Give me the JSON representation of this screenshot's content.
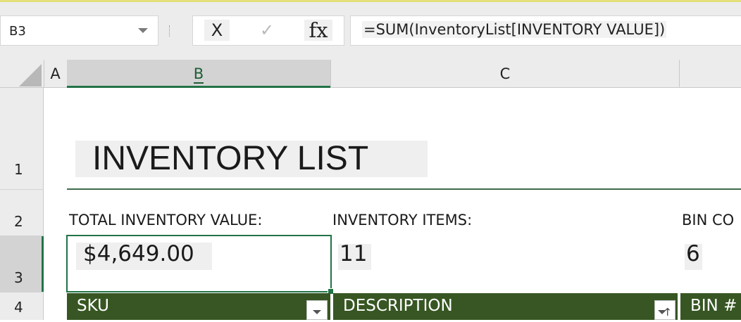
{
  "formula_bar": {
    "name_box": "B3",
    "cancel_label": "X",
    "enter_label": "✓",
    "function_label": "fx",
    "formula": "=SUM(InventoryList[INVENTORY VALUE])"
  },
  "columns": [
    "A",
    "B",
    "C"
  ],
  "rows": [
    "1",
    "2",
    "3",
    "4"
  ],
  "sheet": {
    "title": "INVENTORY LIST",
    "total_label": "TOTAL INVENTORY VALUE:",
    "total_value": "$4,649.00",
    "items_label": "INVENTORY ITEMS:",
    "items_value": "11",
    "bin_label": "BIN CO",
    "bin_value": "6"
  },
  "table_headers": {
    "sku": "SKU",
    "description": "DESCRIPTION",
    "bin": "BIN #"
  },
  "colors": {
    "selection": "#217346",
    "table_header": "#375623",
    "title_rule": "#3e6b4a"
  }
}
